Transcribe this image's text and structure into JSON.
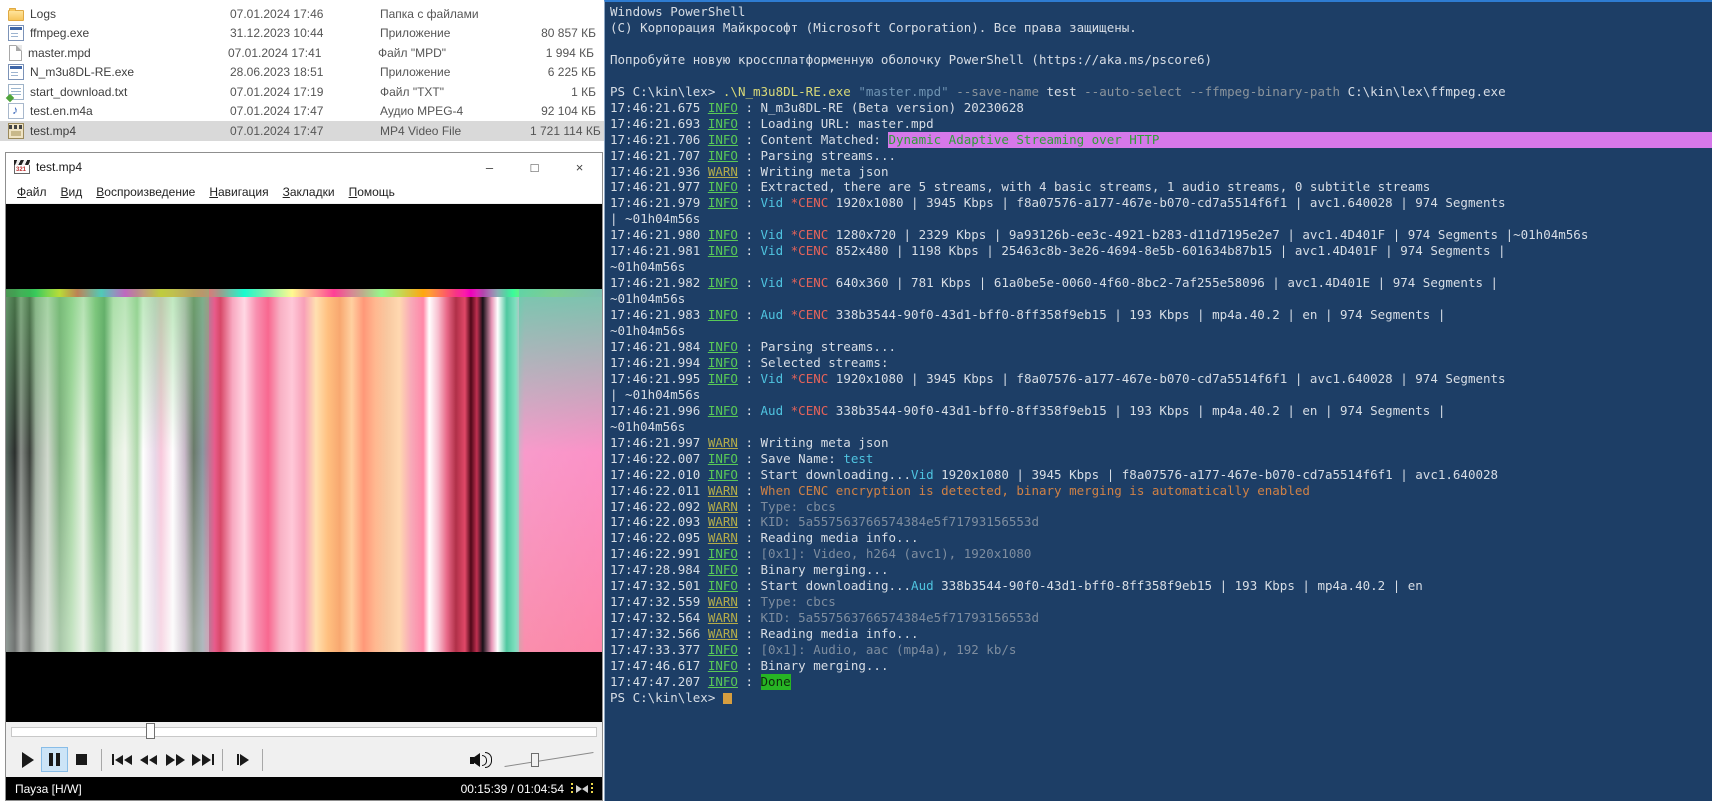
{
  "file_explorer": {
    "rows": [
      {
        "icon": "folder-icon",
        "name": "Logs",
        "date": "07.01.2024 17:46",
        "type": "Папка с файлами",
        "size": "",
        "selected": false
      },
      {
        "icon": "app-icon",
        "name": "ffmpeg.exe",
        "date": "31.12.2023 10:44",
        "type": "Приложение",
        "size": "80 857 КБ",
        "selected": false
      },
      {
        "icon": "file-icon",
        "name": "master.mpd",
        "date": "07.01.2024 17:41",
        "type": "Файл \"MPD\"",
        "size": "1 994 КБ",
        "selected": false
      },
      {
        "icon": "app-icon",
        "name": "N_m3u8DL-RE.exe",
        "date": "28.06.2023 18:51",
        "type": "Приложение",
        "size": "6 225 КБ",
        "selected": false
      },
      {
        "icon": "text-icon",
        "name": "start_download.txt",
        "date": "07.01.2024 17:19",
        "type": "Файл \"TXT\"",
        "size": "1 КБ",
        "selected": false
      },
      {
        "icon": "audio-icon",
        "name": "test.en.m4a",
        "date": "07.01.2024 17:47",
        "type": "Аудио MPEG-4",
        "size": "92 104 КБ",
        "selected": false
      },
      {
        "icon": "video-icon",
        "name": "test.mp4",
        "date": "07.01.2024 17:47",
        "type": "MP4 Video File",
        "size": "1 721 114 КБ",
        "selected": true
      }
    ]
  },
  "player": {
    "title": "test.mp4",
    "window_buttons": [
      {
        "name": "minimize",
        "label": "–"
      },
      {
        "name": "maximize",
        "label": "□"
      },
      {
        "name": "close",
        "label": "×"
      }
    ],
    "menu": [
      "Файл",
      "Вид",
      "Воспроизведение",
      "Навигация",
      "Закладки",
      "Помощь"
    ],
    "controls": [
      {
        "name": "play"
      },
      {
        "name": "pause",
        "active": true
      },
      {
        "name": "stop"
      },
      {
        "separator": true
      },
      {
        "name": "skip-back"
      },
      {
        "name": "rewind"
      },
      {
        "name": "fast-forward"
      },
      {
        "name": "skip-forward"
      },
      {
        "separator": true
      },
      {
        "name": "frame-step"
      },
      {
        "separator": true
      }
    ],
    "seek_percent": 24.1,
    "volume_percent": 30,
    "status_left": "Пауза [H/W]",
    "time": "00:15:39 / 01:04:54"
  },
  "terminal": {
    "lines": [
      [
        {
          "t": "Windows PowerShell",
          "c": "w"
        }
      ],
      [
        {
          "t": "(C) Корпорация Майкрософт (Microsoft Corporation). Все права защищены.",
          "c": "w"
        }
      ],
      [],
      [
        {
          "t": "Попробуйте новую кроссплатформенную оболочку PowerShell (https://aka.ms/pscore6)",
          "c": "w"
        }
      ],
      [],
      [
        {
          "t": "PS C:\\kin\\lex> ",
          "c": "w"
        },
        {
          "t": ".\\N_m3u8DL-RE.exe ",
          "c": "cmd"
        },
        {
          "t": "\"master.mpd\" ",
          "c": "str"
        },
        {
          "t": "--save-name ",
          "c": "param"
        },
        {
          "t": "test ",
          "c": "w"
        },
        {
          "t": "--auto-select ",
          "c": "param"
        },
        {
          "t": "--ffmpeg-binary-path ",
          "c": "param"
        },
        {
          "t": "C:\\kin\\lex\\ffmpeg.exe",
          "c": "w"
        }
      ],
      [
        {
          "t": "17:46:21.675 ",
          "c": "w"
        },
        {
          "t": "INFO",
          "c": "info"
        },
        {
          "t": " : N_m3u8DL-RE (Beta version) 20230628",
          "c": "w"
        }
      ],
      [
        {
          "t": "17:46:21.693 ",
          "c": "w"
        },
        {
          "t": "INFO",
          "c": "info"
        },
        {
          "t": " : Loading URL: master.mpd",
          "c": "w"
        }
      ],
      [
        {
          "t": "17:46:21.706 ",
          "c": "w"
        },
        {
          "t": "INFO",
          "c": "info"
        },
        {
          "t": " : Content Matched: ",
          "c": "w"
        },
        {
          "t": "Dynamic Adaptive Streaming over HTTP",
          "c": "hl"
        }
      ],
      [
        {
          "t": "17:46:21.707 ",
          "c": "w"
        },
        {
          "t": "INFO",
          "c": "info"
        },
        {
          "t": " : Parsing streams...",
          "c": "w"
        }
      ],
      [
        {
          "t": "17:46:21.936 ",
          "c": "w"
        },
        {
          "t": "WARN",
          "c": "warn"
        },
        {
          "t": " : Writing meta json",
          "c": "w"
        }
      ],
      [
        {
          "t": "17:46:21.977 ",
          "c": "w"
        },
        {
          "t": "INFO",
          "c": "info"
        },
        {
          "t": " : Extracted, there are 5 streams, with 4 basic streams, 1 audio streams, 0 subtitle streams",
          "c": "w"
        }
      ],
      [
        {
          "t": "17:46:21.979 ",
          "c": "w"
        },
        {
          "t": "INFO",
          "c": "info"
        },
        {
          "t": " : ",
          "c": "w"
        },
        {
          "t": "Vid ",
          "c": "cyan"
        },
        {
          "t": "*CENC ",
          "c": "red"
        },
        {
          "t": "1920x1080 | 3945 Kbps | f8a07576-a177-467e-b070-cd7a5514f6f1 | avc1.640028 | 974 Segments",
          "c": "w"
        }
      ],
      [
        {
          "t": "| ~01h04m56s",
          "c": "w"
        }
      ],
      [
        {
          "t": "17:46:21.980 ",
          "c": "w"
        },
        {
          "t": "INFO",
          "c": "info"
        },
        {
          "t": " : ",
          "c": "w"
        },
        {
          "t": "Vid ",
          "c": "cyan"
        },
        {
          "t": "*CENC ",
          "c": "red"
        },
        {
          "t": "1280x720 | 2329 Kbps | 9a93126b-ee3c-4921-b283-d11d7195e2e7 | avc1.4D401F | 974 Segments |~01h04m56s",
          "c": "w"
        }
      ],
      [
        {
          "t": "17:46:21.981 ",
          "c": "w"
        },
        {
          "t": "INFO",
          "c": "info"
        },
        {
          "t": " : ",
          "c": "w"
        },
        {
          "t": "Vid ",
          "c": "cyan"
        },
        {
          "t": "*CENC ",
          "c": "red"
        },
        {
          "t": "852x480 | 1198 Kbps | 25463c8b-3e26-4694-8e5b-601634b87b15 | avc1.4D401F | 974 Segments |",
          "c": "w"
        }
      ],
      [
        {
          "t": "~01h04m56s",
          "c": "w"
        }
      ],
      [
        {
          "t": "17:46:21.982 ",
          "c": "w"
        },
        {
          "t": "INFO",
          "c": "info"
        },
        {
          "t": " : ",
          "c": "w"
        },
        {
          "t": "Vid ",
          "c": "cyan"
        },
        {
          "t": "*CENC ",
          "c": "red"
        },
        {
          "t": "640x360 | 781 Kbps | 61a0be5e-0060-4f60-8bc2-7af255e58096 | avc1.4D401E | 974 Segments |",
          "c": "w"
        }
      ],
      [
        {
          "t": "~01h04m56s",
          "c": "w"
        }
      ],
      [
        {
          "t": "17:46:21.983 ",
          "c": "w"
        },
        {
          "t": "INFO",
          "c": "info"
        },
        {
          "t": " : ",
          "c": "w"
        },
        {
          "t": "Aud ",
          "c": "cyan"
        },
        {
          "t": "*CENC ",
          "c": "red"
        },
        {
          "t": "338b3544-90f0-43d1-bff0-8ff358f9eb15 | 193 Kbps | mp4a.40.2 | en | 974 Segments |",
          "c": "w"
        }
      ],
      [
        {
          "t": "~01h04m56s",
          "c": "w"
        }
      ],
      [
        {
          "t": "17:46:21.984 ",
          "c": "w"
        },
        {
          "t": "INFO",
          "c": "info"
        },
        {
          "t": " : Parsing streams...",
          "c": "w"
        }
      ],
      [
        {
          "t": "17:46:21.994 ",
          "c": "w"
        },
        {
          "t": "INFO",
          "c": "info"
        },
        {
          "t": " : Selected streams:",
          "c": "w"
        }
      ],
      [
        {
          "t": "17:46:21.995 ",
          "c": "w"
        },
        {
          "t": "INFO",
          "c": "info"
        },
        {
          "t": " : ",
          "c": "w"
        },
        {
          "t": "Vid ",
          "c": "cyan"
        },
        {
          "t": "*CENC ",
          "c": "red"
        },
        {
          "t": "1920x1080 | 3945 Kbps | f8a07576-a177-467e-b070-cd7a5514f6f1 | avc1.640028 | 974 Segments",
          "c": "w"
        }
      ],
      [
        {
          "t": "| ~01h04m56s",
          "c": "w"
        }
      ],
      [
        {
          "t": "17:46:21.996 ",
          "c": "w"
        },
        {
          "t": "INFO",
          "c": "info"
        },
        {
          "t": " : ",
          "c": "w"
        },
        {
          "t": "Aud ",
          "c": "cyan"
        },
        {
          "t": "*CENC ",
          "c": "red"
        },
        {
          "t": "338b3544-90f0-43d1-bff0-8ff358f9eb15 | 193 Kbps | mp4a.40.2 | en | 974 Segments |",
          "c": "w"
        }
      ],
      [
        {
          "t": "~01h04m56s",
          "c": "w"
        }
      ],
      [
        {
          "t": "17:46:21.997 ",
          "c": "w"
        },
        {
          "t": "WARN",
          "c": "warn"
        },
        {
          "t": " : Writing meta json",
          "c": "w"
        }
      ],
      [
        {
          "t": "17:46:22.007 ",
          "c": "w"
        },
        {
          "t": "INFO",
          "c": "info"
        },
        {
          "t": " : Save Name: ",
          "c": "w"
        },
        {
          "t": "test",
          "c": "cyan"
        }
      ],
      [
        {
          "t": "17:46:22.010 ",
          "c": "w"
        },
        {
          "t": "INFO",
          "c": "info"
        },
        {
          "t": " : Start downloading...",
          "c": "w"
        },
        {
          "t": "Vid ",
          "c": "cyan"
        },
        {
          "t": "1920x1080 | 3945 Kbps | f8a07576-a177-467e-b070-cd7a5514f6f1 | avc1.640028",
          "c": "w"
        }
      ],
      [
        {
          "t": "17:46:22.011 ",
          "c": "w"
        },
        {
          "t": "WARN",
          "c": "warn"
        },
        {
          "t": " : ",
          "c": "w"
        },
        {
          "t": "When CENC encryption is detected, binary merging is automatically enabled",
          "c": "orange"
        }
      ],
      [
        {
          "t": "17:46:22.092 ",
          "c": "w"
        },
        {
          "t": "WARN",
          "c": "warn"
        },
        {
          "t": " : ",
          "c": "w"
        },
        {
          "t": "Type: cbcs",
          "c": "dim"
        }
      ],
      [
        {
          "t": "17:46:22.093 ",
          "c": "w"
        },
        {
          "t": "WARN",
          "c": "warn"
        },
        {
          "t": " : ",
          "c": "w"
        },
        {
          "t": "KID: 5a557563766574384e5f71793156553d",
          "c": "dim"
        }
      ],
      [
        {
          "t": "17:46:22.095 ",
          "c": "w"
        },
        {
          "t": "WARN",
          "c": "warn"
        },
        {
          "t": " : Reading media info...",
          "c": "w"
        }
      ],
      [
        {
          "t": "17:46:22.991 ",
          "c": "w"
        },
        {
          "t": "INFO",
          "c": "info"
        },
        {
          "t": " : ",
          "c": "w"
        },
        {
          "t": "[0x1]: Video, h264 (avc1), 1920x1080",
          "c": "dim"
        }
      ],
      [
        {
          "t": "17:47:28.984 ",
          "c": "w"
        },
        {
          "t": "INFO",
          "c": "info"
        },
        {
          "t": " : Binary merging...",
          "c": "w"
        }
      ],
      [
        {
          "t": "17:47:32.501 ",
          "c": "w"
        },
        {
          "t": "INFO",
          "c": "info"
        },
        {
          "t": " : Start downloading...",
          "c": "w"
        },
        {
          "t": "Aud ",
          "c": "cyan"
        },
        {
          "t": "338b3544-90f0-43d1-bff0-8ff358f9eb15 | 193 Kbps | mp4a.40.2 | en",
          "c": "w"
        }
      ],
      [
        {
          "t": "17:47:32.559 ",
          "c": "w"
        },
        {
          "t": "WARN",
          "c": "warn"
        },
        {
          "t": " : ",
          "c": "w"
        },
        {
          "t": "Type: cbcs",
          "c": "dim"
        }
      ],
      [
        {
          "t": "17:47:32.564 ",
          "c": "w"
        },
        {
          "t": "WARN",
          "c": "warn"
        },
        {
          "t": " : ",
          "c": "w"
        },
        {
          "t": "KID: 5a557563766574384e5f71793156553d",
          "c": "dim"
        }
      ],
      [
        {
          "t": "17:47:32.566 ",
          "c": "w"
        },
        {
          "t": "WARN",
          "c": "warn"
        },
        {
          "t": " : Reading media info...",
          "c": "w"
        }
      ],
      [
        {
          "t": "17:47:33.377 ",
          "c": "w"
        },
        {
          "t": "INFO",
          "c": "info"
        },
        {
          "t": " : ",
          "c": "w"
        },
        {
          "t": "[0x1]: Audio, aac (mp4a), 192 kb/s",
          "c": "dim"
        }
      ],
      [
        {
          "t": "17:47:46.617 ",
          "c": "w"
        },
        {
          "t": "INFO",
          "c": "info"
        },
        {
          "t": " : Binary merging...",
          "c": "w"
        }
      ],
      [
        {
          "t": "17:47:47.207 ",
          "c": "w"
        },
        {
          "t": "INFO",
          "c": "info"
        },
        {
          "t": " : ",
          "c": "w"
        },
        {
          "t": "Done",
          "c": "done"
        }
      ],
      [
        {
          "t": "PS C:\\kin\\lex> ",
          "c": "w"
        },
        {
          "t": "",
          "c": "cursor"
        }
      ]
    ]
  },
  "colors": {
    "terminal_bg": "#1d3e66",
    "terminal_text": "#d7dde5",
    "info_green": "#59c957",
    "warn_yellow": "#b3ab4a",
    "stream_cyan": "#4fc4e0",
    "cenc_red": "#e5635a",
    "warn_orange": "#cf8146",
    "dim_gray": "#7e8d9f",
    "highlight_violet": "#d678ea",
    "done_green": "#27b424",
    "cursor_orange": "#d79e3f",
    "selected_row_gray": "#d9d9d9",
    "pause_active_blue": "#cce4f7"
  }
}
